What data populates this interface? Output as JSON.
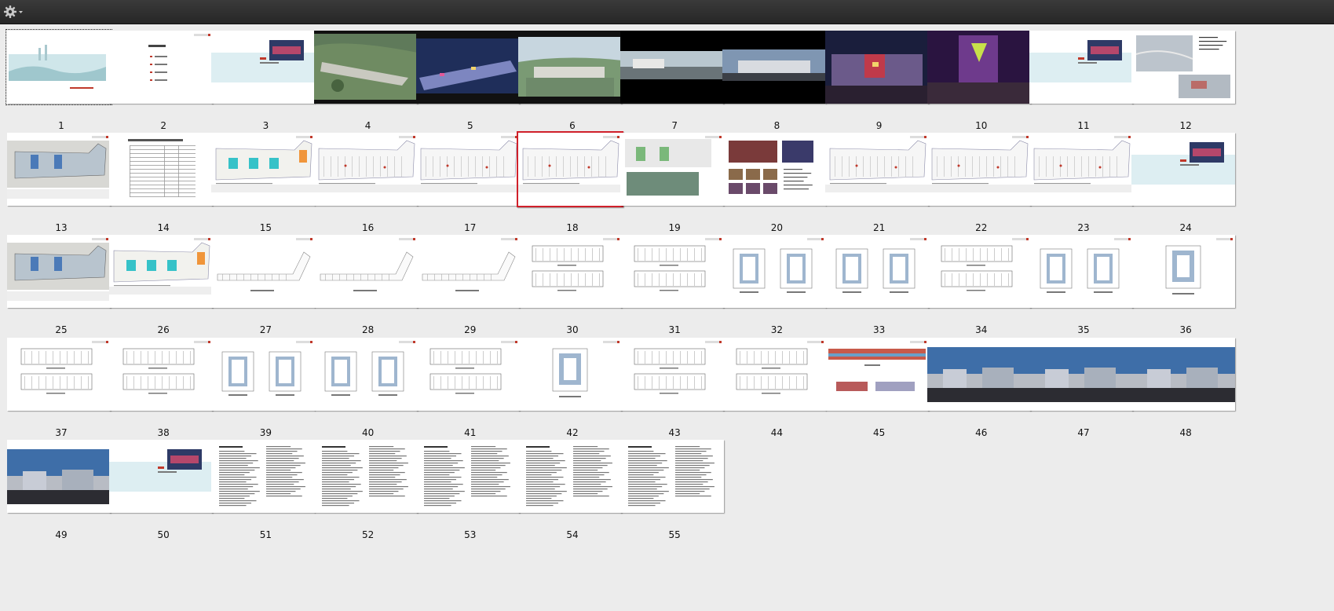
{
  "toolbar": {
    "options_icon": "gear-icon",
    "dropdown_icon": "chevron-down-icon"
  },
  "selected_page": "18",
  "current_page": "1",
  "accent_color": "#d0202a",
  "pages": [
    {
      "label": "1",
      "kind": "cover"
    },
    {
      "label": "2",
      "kind": "toc"
    },
    {
      "label": "3",
      "kind": "section"
    },
    {
      "label": "4",
      "kind": "aerial"
    },
    {
      "label": "5",
      "kind": "night"
    },
    {
      "label": "6",
      "kind": "panorama"
    },
    {
      "label": "7",
      "kind": "strip"
    },
    {
      "label": "8",
      "kind": "strip2"
    },
    {
      "label": "9",
      "kind": "night2"
    },
    {
      "label": "10",
      "kind": "night3"
    },
    {
      "label": "11",
      "kind": "section"
    },
    {
      "label": "12",
      "kind": "map"
    },
    {
      "label": "13",
      "kind": "siteplan"
    },
    {
      "label": "14",
      "kind": "table"
    },
    {
      "label": "15",
      "kind": "plancolor"
    },
    {
      "label": "16",
      "kind": "planline"
    },
    {
      "label": "17",
      "kind": "planline"
    },
    {
      "label": "18",
      "kind": "planline"
    },
    {
      "label": "19",
      "kind": "mixed"
    },
    {
      "label": "20",
      "kind": "photos"
    },
    {
      "label": "21",
      "kind": "planline"
    },
    {
      "label": "22",
      "kind": "planline"
    },
    {
      "label": "23",
      "kind": "planline"
    },
    {
      "label": "24",
      "kind": "section"
    },
    {
      "label": "25",
      "kind": "siteplan"
    },
    {
      "label": "26",
      "kind": "plancolor"
    },
    {
      "label": "27",
      "kind": "drawing"
    },
    {
      "label": "28",
      "kind": "drawing"
    },
    {
      "label": "29",
      "kind": "drawing"
    },
    {
      "label": "30",
      "kind": "elevation"
    },
    {
      "label": "31",
      "kind": "elevation"
    },
    {
      "label": "32",
      "kind": "twoplans"
    },
    {
      "label": "33",
      "kind": "twoplans"
    },
    {
      "label": "34",
      "kind": "elevation"
    },
    {
      "label": "35",
      "kind": "twoplans"
    },
    {
      "label": "36",
      "kind": "oneplan"
    },
    {
      "label": "37",
      "kind": "elevation"
    },
    {
      "label": "38",
      "kind": "elevation"
    },
    {
      "label": "39",
      "kind": "twoplans"
    },
    {
      "label": "40",
      "kind": "twoplans"
    },
    {
      "label": "41",
      "kind": "elevation"
    },
    {
      "label": "42",
      "kind": "oneplan"
    },
    {
      "label": "43",
      "kind": "elevation"
    },
    {
      "label": "44",
      "kind": "elevation"
    },
    {
      "label": "45",
      "kind": "colorelev"
    },
    {
      "label": "46",
      "kind": "sky"
    },
    {
      "label": "47",
      "kind": "sky"
    },
    {
      "label": "48",
      "kind": "sky"
    },
    {
      "label": "49",
      "kind": "sky"
    },
    {
      "label": "50",
      "kind": "section"
    },
    {
      "label": "51",
      "kind": "text"
    },
    {
      "label": "52",
      "kind": "text"
    },
    {
      "label": "53",
      "kind": "text"
    },
    {
      "label": "54",
      "kind": "text"
    },
    {
      "label": "55",
      "kind": "text"
    }
  ]
}
